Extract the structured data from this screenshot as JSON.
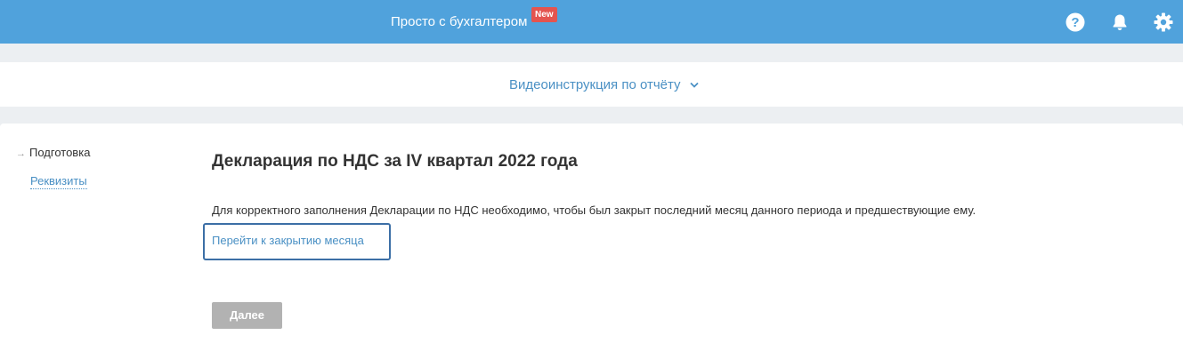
{
  "header": {
    "title": "Просто с бухгалтером",
    "new_badge": "New",
    "icons": [
      "question-icon",
      "bell-icon",
      "gear-icon"
    ],
    "background_color": "#50a2dc",
    "badge_color": "#e4544f"
  },
  "video_instruction": {
    "label": "Видеоинструкция по отчёту",
    "icon": "chevron-down-icon",
    "link_color": "#4a90c4"
  },
  "steps": {
    "current": "Подготовка",
    "next": "Реквизиты"
  },
  "main": {
    "title": "Декларация по НДС за IV квартал 2022 года",
    "info": "Для корректного заполнения Декларации по НДС необходимо, чтобы был закрыт последний месяц данного периода и предшествующие ему.",
    "close_month_link": "Перейти к закрытию месяца",
    "next_button": "Далее",
    "next_button_color": "#b2b2b2"
  }
}
